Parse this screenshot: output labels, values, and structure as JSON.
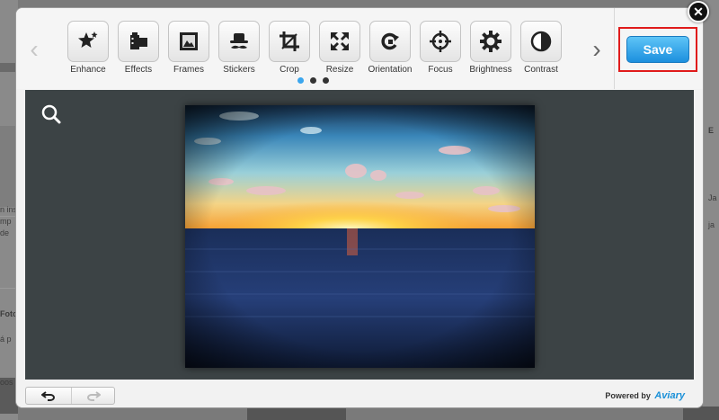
{
  "toolbar": {
    "tools": [
      {
        "label": "Enhance",
        "icon": "star-wand-icon"
      },
      {
        "label": "Effects",
        "icon": "film-icon"
      },
      {
        "label": "Frames",
        "icon": "frame-icon"
      },
      {
        "label": "Stickers",
        "icon": "hat-mustache-icon"
      },
      {
        "label": "Crop",
        "icon": "crop-icon"
      },
      {
        "label": "Resize",
        "icon": "resize-arrows-icon"
      },
      {
        "label": "Orientation",
        "icon": "rotate-icon"
      },
      {
        "label": "Focus",
        "icon": "crosshair-icon"
      },
      {
        "label": "Brightness",
        "icon": "sun-gear-icon"
      },
      {
        "label": "Contrast",
        "icon": "half-circle-icon"
      }
    ],
    "page_dots": 3,
    "active_page": 1,
    "save_label": "Save"
  },
  "footer": {
    "powered_prefix": "Powered by",
    "brand": "Aviary"
  },
  "background_fragments": [
    "n ins",
    "mp",
    "de",
    "Foto",
    "á p",
    "oos",
    "Ja",
    "ja",
    "E"
  ],
  "colors": {
    "save_blue": "#1c8fde",
    "highlight_red": "#e01b1b",
    "canvas_bg": "#3c4345"
  }
}
